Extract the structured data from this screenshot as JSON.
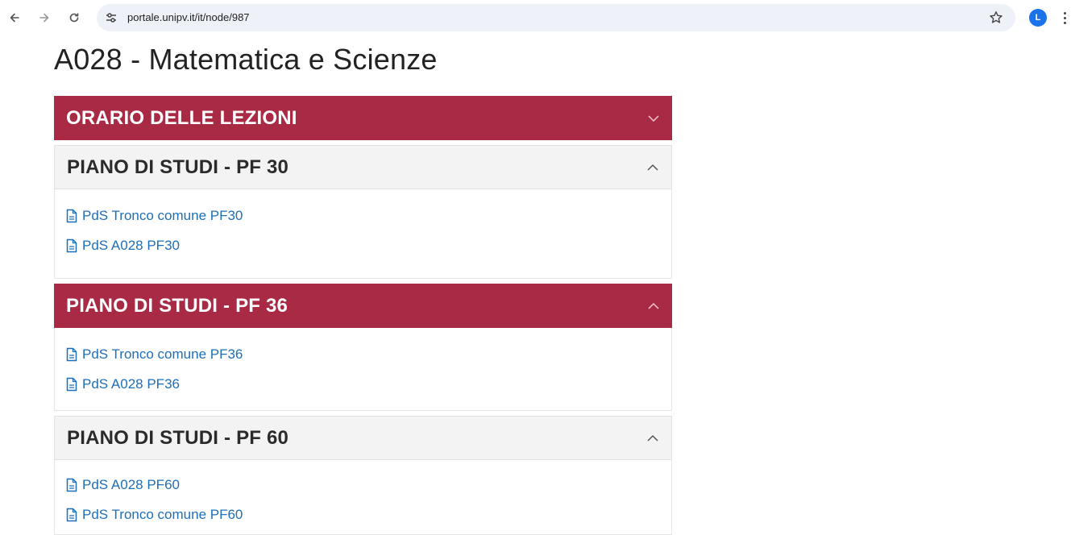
{
  "browser": {
    "url": "portale.unipv.it/it/node/987",
    "avatar_letter": "L",
    "icons": [
      "back-arrow-icon",
      "forward-arrow-icon",
      "reload-icon",
      "site-settings-icon",
      "bookmark-star-icon",
      "kebab-menu-icon"
    ]
  },
  "page": {
    "title": "A028 - Matematica e Scienze"
  },
  "colors": {
    "accent_red": "#a82a45",
    "link_blue": "#1d6fb8",
    "header_grey": "#f3f3f3"
  },
  "sections": [
    {
      "title": "ORARIO DELLE LEZIONI",
      "state": "collapsed",
      "icon": "chevron-down-icon",
      "links": []
    },
    {
      "title": "PIANO DI STUDI - PF 30",
      "state": "expanded",
      "icon": "chevron-up-icon",
      "links": [
        "PdS Tronco comune PF30",
        "PdS A028 PF30"
      ]
    },
    {
      "title": "PIANO DI STUDI - PF 36",
      "state": "expanded",
      "icon": "chevron-up-icon",
      "links": [
        "PdS Tronco comune PF36",
        "PdS A028 PF36"
      ]
    },
    {
      "title": "PIANO DI STUDI - PF 60",
      "state": "expanded",
      "icon": "chevron-up-icon",
      "links": [
        "PdS A028 PF60",
        "PdS Tronco comune PF60"
      ]
    }
  ]
}
